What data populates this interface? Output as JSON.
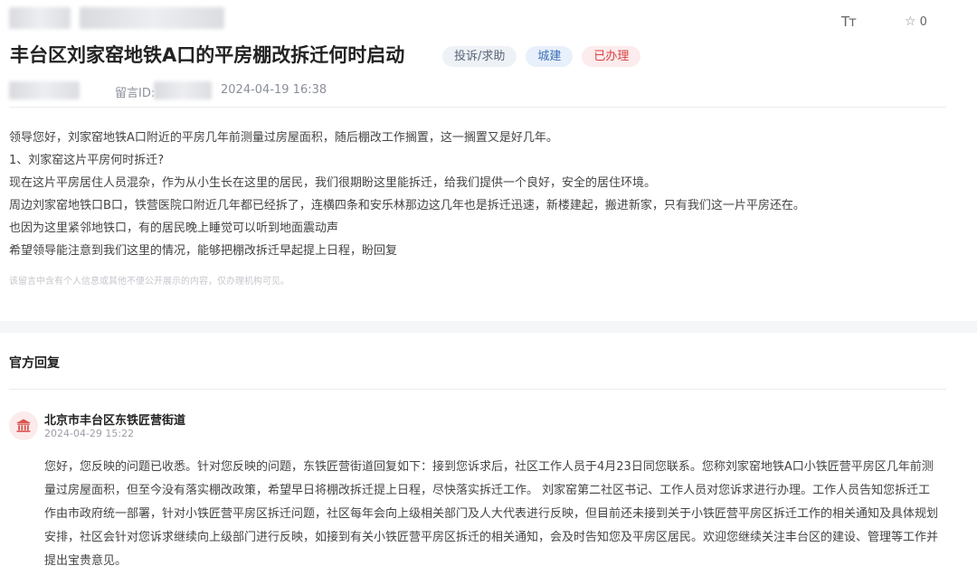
{
  "toolbar": {
    "font_size_icon": "Tт",
    "star_icon": "star-outline-icon",
    "favorite_count": "0"
  },
  "post": {
    "title": "丰台区刘家窑地铁A口的平房棚改拆迁何时启动",
    "tags": {
      "category": "投诉/求助",
      "topic": "城建",
      "status": "已办理"
    },
    "message_id_label": "留言ID:",
    "date": "2024-04-19 16:38",
    "body": [
      "领导您好，刘家窑地铁A口附近的平房几年前测量过房屋面积，随后棚改工作搁置，这一搁置又是好几年。",
      "1、刘家窑这片平房何时拆迁?",
      "现在这片平房居住人员混杂，作为从小生长在这里的居民，我们很期盼这里能拆迁，给我们提供一个良好，安全的居住环境。",
      "周边刘家窑地铁口B口，铁营医院口附近几年都已经拆了，连横四条和安乐林那边这几年也是拆迁迅速，新楼建起，搬进新家，只有我们这一片平房还在。",
      "也因为这里紧邻地铁口，有的居民晚上睡觉可以听到地面震动声",
      "希望领导能注意到我们这里的情况，能够把棚改拆迁早起提上日程，盼回复"
    ],
    "privacy_notice": "该留言中含有个人信息或其他不便公开展示的内容，仅办理机构可见。"
  },
  "reply": {
    "heading": "官方回复",
    "office_icon": "government-building-icon",
    "office_name": "北京市丰台区东铁匠营街道",
    "date": "2024-04-29 15:22",
    "body": [
      "您好，您反映的问题已收悉。针对您反映的问题，东铁匠营街道回复如下：接到您诉求后，社区工作人员于4月23日同您联系。您称刘家窑地铁A口小铁匠营平房区几年前测",
      "量过房屋面积，但至今没有落实棚改政策，希望早日将棚改拆迁提上日程，尽快落实拆迁工作。 刘家窑第二社区书记、工作人员对您诉求进行办理。工作人员告知您拆迁工",
      "作由市政府统一部署，针对小铁匠营平房区拆迁问题，社区每年会向上级相关部门及人大代表进行反映，但目前还未接到关于小铁匠营平房区拆迁工作的相关通知及具体规划",
      "安排，社区会针对您诉求继续向上级部门进行反映，如接到有关小铁匠营平房区拆迁的相关通知，会及时告知您及平房区居民。欢迎您继续关注丰台区的建设、管理等工作并",
      "提出宝贵意见。"
    ]
  }
}
